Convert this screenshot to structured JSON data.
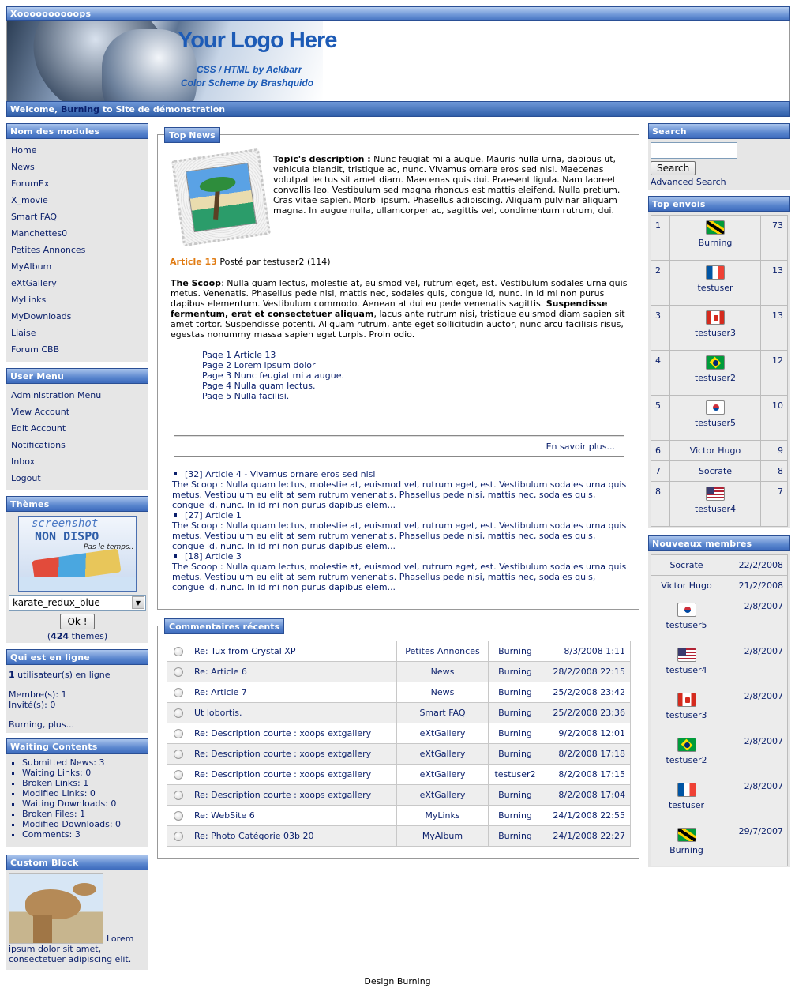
{
  "site": {
    "title": "Xoooooooooops",
    "logo_title": "Your Logo Here",
    "logo_line1": "CSS / HTML by Ackbarr",
    "logo_line2": "Color Scheme by Brashquido",
    "welcome_prefix": "Welcome,",
    "welcome_user": "Burning",
    "welcome_suffix": "to Site de démonstration",
    "footer": "Design Burning"
  },
  "modules": {
    "heading": "Nom des modules",
    "items": [
      "Home",
      "News",
      "ForumEx",
      "X_movie",
      "Smart FAQ",
      "Manchettes0",
      "Petites Annonces",
      "MyAlbum",
      "eXtGallery",
      "MyLinks",
      "MyDownloads",
      "Liaise",
      "Forum CBB"
    ]
  },
  "user_menu": {
    "heading": "User Menu",
    "items": [
      "Administration Menu",
      "View Account",
      "Edit Account",
      "Notifications",
      "Inbox",
      "Logout"
    ]
  },
  "themes": {
    "heading": "Thèmes",
    "screenshot_line1": "screenshot",
    "screenshot_line2": "NON DISPO",
    "screenshot_line3": "Pas le temps..",
    "selected": "karate_redux_blue",
    "ok_label": "Ok !",
    "count": "424",
    "count_suffix": "themes)",
    "count_prefix": "("
  },
  "online": {
    "heading": "Qui est en ligne",
    "count": "1",
    "count_text": "utilisateur(s) en ligne",
    "members": "Membre(s): 1",
    "guests": "Invité(s): 0",
    "more": "Burning, plus..."
  },
  "waiting": {
    "heading": "Waiting Contents",
    "items": [
      "Submitted News: 3",
      "Waiting Links: 0",
      "Broken Links: 1",
      "Modified Links: 0",
      "Waiting Downloads: 0",
      "Broken Files: 1",
      "Modified Downloads: 0",
      "Comments: 3"
    ]
  },
  "custom": {
    "heading": "Custom Block",
    "link": "Lorem",
    "text": "ipsum dolor sit amet, consectetuer adipiscing elit."
  },
  "top_news": {
    "heading": "Top News",
    "topic_label": "Topic's description :",
    "topic_text": "Nunc feugiat mi a augue. Mauris nulla urna, dapibus ut, vehicula blandit, tristique ac, nunc. Vivamus ornare eros sed nisl. Maecenas volutpat lectus sit amet diam. Maecenas quis dui. Praesent ligula. Nam laoreet convallis leo. Vestibulum sed magna rhoncus est mattis eleifend. Nulla pretium. Cras vitae sapien. Morbi ipsum. Phasellus adipiscing. Aliquam pulvinar aliquam magna. In augue nulla, ullamcorper ac, sagittis vel, condimentum rutrum, dui.",
    "article_title": "Article 13",
    "article_meta": "Posté par testuser2 (114)",
    "scoop_label": "The Scoop",
    "scoop_text1": ": Nulla quam lectus, molestie at, euismod vel, rutrum eget, est. Vestibulum sodales urna quis metus. Venenatis. Phasellus pede nisi, mattis nec, sodales quis, congue id, nunc. In id mi non purus dapibus elementum. Vestibulum commodo. Aenean at dui eu pede venenatis sagittis.",
    "scoop_bold": "Suspendisse fermentum, erat et consectetuer aliquam",
    "scoop_text2": ", lacus ante rutrum nisi, tristique euismod diam sapien sit amet tortor. Suspendisse potenti. Aliquam rutrum, ante eget sollicitudin auctor, nunc arcu facilisis risus, egestas nonummy massa sapien eget turpis. Proin odio.",
    "pages": [
      "Page 1 Article 13",
      "Page 2 Lorem ipsum dolor",
      "Page 3 Nunc feugiat mi a augue.",
      "Page 4 Nulla quam lectus.",
      "Page 5 Nulla facilisi."
    ],
    "read_more": "En savoir plus...",
    "others": [
      {
        "title": "[32] Article 4 - Vivamus ornare eros sed nisl",
        "text": "The Scoop : Nulla quam lectus, molestie at, euismod vel, rutrum eget, est. Vestibulum sodales urna quis metus. Vestibulum eu elit at sem rutrum venenatis. Phasellus pede nisi, mattis nec, sodales quis, congue id, nunc. In id mi non purus dapibus elem..."
      },
      {
        "title": "[27] Article 1",
        "text": "The Scoop : Nulla quam lectus, molestie at, euismod vel, rutrum eget, est. Vestibulum sodales urna quis metus. Vestibulum eu elit at sem rutrum venenatis. Phasellus pede nisi, mattis nec, sodales quis, congue id, nunc. In id mi non purus dapibus elem..."
      },
      {
        "title": "[18] Article 3",
        "text": "The Scoop : Nulla quam lectus, molestie at, euismod vel, rutrum eget, est. Vestibulum sodales urna quis metus. Vestibulum eu elit at sem rutrum venenatis. Phasellus pede nisi, mattis nec, sodales quis, congue id, nunc. In id mi non purus dapibus elem..."
      }
    ]
  },
  "comments": {
    "heading": "Commentaires récents",
    "rows": [
      {
        "title": "Re: Tux from Crystal XP",
        "module": "Petites Annonces",
        "user": "Burning",
        "date": "8/3/2008 1:11"
      },
      {
        "title": "Re: Article 6",
        "module": "News",
        "user": "Burning",
        "date": "28/2/2008 22:15"
      },
      {
        "title": "Re: Article 7",
        "module": "News",
        "user": "Burning",
        "date": "25/2/2008 23:42"
      },
      {
        "title": "Ut lobortis.",
        "module": "Smart FAQ",
        "user": "Burning",
        "date": "25/2/2008 23:36"
      },
      {
        "title": "Re: Description courte : xoops extgallery",
        "module": "eXtGallery",
        "user": "Burning",
        "date": "9/2/2008 12:01"
      },
      {
        "title": "Re: Description courte : xoops extgallery",
        "module": "eXtGallery",
        "user": "Burning",
        "date": "8/2/2008 17:18"
      },
      {
        "title": "Re: Description courte : xoops extgallery",
        "module": "eXtGallery",
        "user": "testuser2",
        "date": "8/2/2008 17:15"
      },
      {
        "title": "Re: Description courte : xoops extgallery",
        "module": "eXtGallery",
        "user": "Burning",
        "date": "8/2/2008 17:04"
      },
      {
        "title": "Re: WebSite 6",
        "module": "MyLinks",
        "user": "Burning",
        "date": "24/1/2008 22:55"
      },
      {
        "title": "Re: Photo Catégorie 03b 20",
        "module": "MyAlbum",
        "user": "Burning",
        "date": "24/1/2008 22:27"
      }
    ]
  },
  "search": {
    "heading": "Search",
    "value": "",
    "button": "Search",
    "advanced": "Advanced Search"
  },
  "top_envois": {
    "heading": "Top envois",
    "rows": [
      {
        "rank": "1",
        "flag": "jm",
        "name": "Burning",
        "count": "73"
      },
      {
        "rank": "2",
        "flag": "fr",
        "name": "testuser",
        "count": "13"
      },
      {
        "rank": "3",
        "flag": "ca",
        "name": "testuser3",
        "count": "13"
      },
      {
        "rank": "4",
        "flag": "br",
        "name": "testuser2",
        "count": "12"
      },
      {
        "rank": "5",
        "flag": "kr",
        "name": "testuser5",
        "count": "10"
      },
      {
        "rank": "6",
        "flag": "",
        "name": "Victor Hugo",
        "count": "9"
      },
      {
        "rank": "7",
        "flag": "",
        "name": "Socrate",
        "count": "8"
      },
      {
        "rank": "8",
        "flag": "us",
        "name": "testuser4",
        "count": "7"
      }
    ]
  },
  "new_members": {
    "heading": "Nouveaux membres",
    "rows": [
      {
        "flag": "",
        "name": "Socrate",
        "date": "22/2/2008"
      },
      {
        "flag": "",
        "name": "Victor Hugo",
        "date": "21/2/2008"
      },
      {
        "flag": "kr",
        "name": "testuser5",
        "date": "2/8/2007"
      },
      {
        "flag": "us",
        "name": "testuser4",
        "date": "2/8/2007"
      },
      {
        "flag": "ca",
        "name": "testuser3",
        "date": "2/8/2007"
      },
      {
        "flag": "br",
        "name": "testuser2",
        "date": "2/8/2007"
      },
      {
        "flag": "fr",
        "name": "testuser",
        "date": "2/8/2007"
      },
      {
        "flag": "jm",
        "name": "Burning",
        "date": "29/7/2007"
      }
    ]
  }
}
